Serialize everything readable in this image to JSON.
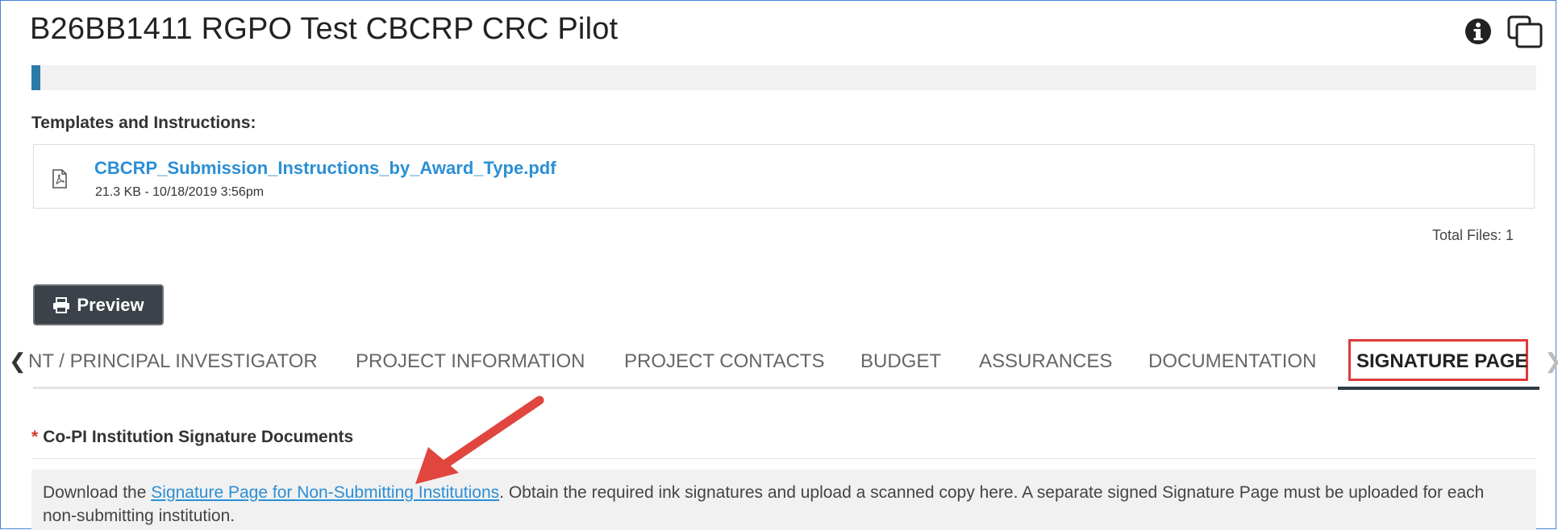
{
  "header": {
    "title": "B26BB1411 RGPO Test CBCRP CRC Pilot",
    "info_icon": "info-circle-icon",
    "copy_icon": "copy-window-icon"
  },
  "progress": {
    "value_fraction": 0.006,
    "color": "#2a7aa8"
  },
  "templates": {
    "label": "Templates and Instructions:",
    "files": [
      {
        "icon": "pdf-file-icon",
        "name": "CBCRP_Submission_Instructions_by_Award_Type.pdf",
        "meta": "21.3 KB - 10/18/2019 3:56pm"
      }
    ],
    "total": "Total Files: 1"
  },
  "preview_button": {
    "icon": "print-icon",
    "label": "Preview"
  },
  "tabs": {
    "items": [
      {
        "label": "NT / PRINCIPAL INVESTIGATOR",
        "active": false
      },
      {
        "label": "PROJECT INFORMATION",
        "active": false
      },
      {
        "label": "PROJECT CONTACTS",
        "active": false
      },
      {
        "label": "BUDGET",
        "active": false
      },
      {
        "label": "ASSURANCES",
        "active": false
      },
      {
        "label": "DOCUMENTATION",
        "active": false
      },
      {
        "label": "SIGNATURE PAGE",
        "active": true
      }
    ],
    "highlight_color": "#e03a3a"
  },
  "signature_section": {
    "required_marker": "*",
    "label": "Co-PI Institution Signature Documents",
    "text_before": "Download the ",
    "link_text": "Signature Page for Non-Submitting Institutions",
    "text_after": ". Obtain the required ink signatures and upload a scanned copy here. A separate signed Signature Page must be uploaded for each non-submitting institution."
  },
  "annotation": {
    "arrow_color": "#e0463e"
  }
}
